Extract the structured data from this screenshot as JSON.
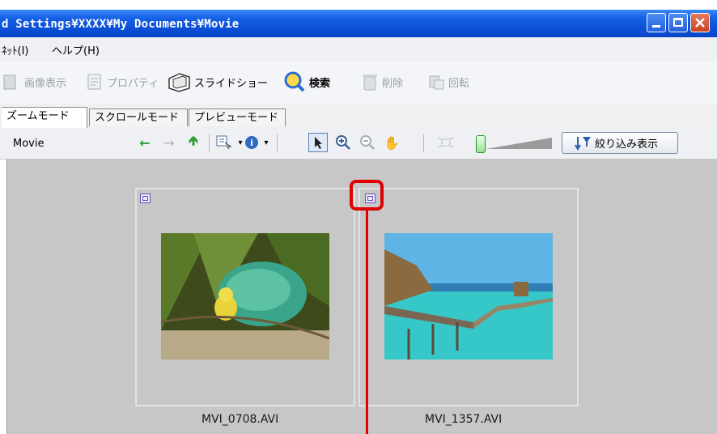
{
  "window": {
    "title": "d Settings¥XXXX¥My Documents¥Movie",
    "colors": {
      "titlebar": "#0b4fd6",
      "close": "#c9421e"
    }
  },
  "menu": [
    {
      "label": "ﾈｯﾄ(I)"
    },
    {
      "label": "ヘルプ(H)"
    }
  ],
  "toolbar": [
    {
      "label": "画像表示",
      "icon": "image-view-icon",
      "enabled": false
    },
    {
      "label": "プロパティ",
      "icon": "properties-icon",
      "enabled": false
    },
    {
      "label": "スライドショー",
      "icon": "slideshow-icon",
      "enabled": true
    },
    {
      "label": "検索",
      "icon": "search-icon",
      "enabled": true
    },
    {
      "label": "削除",
      "icon": "trash-icon",
      "enabled": false
    },
    {
      "label": "回転",
      "icon": "rotate-icon",
      "enabled": false
    }
  ],
  "tabs": [
    {
      "label": "ズームモード",
      "active": true
    },
    {
      "label": "スクロールモード",
      "active": false
    },
    {
      "label": "プレビューモード",
      "active": false
    }
  ],
  "nav": {
    "path": "Movie",
    "filter_label": "絞り込み表示",
    "zoom_slider_value": 0.0
  },
  "files": [
    {
      "name": "MVI_0708.AVI"
    },
    {
      "name": "MVI_1357.AVI"
    }
  ]
}
